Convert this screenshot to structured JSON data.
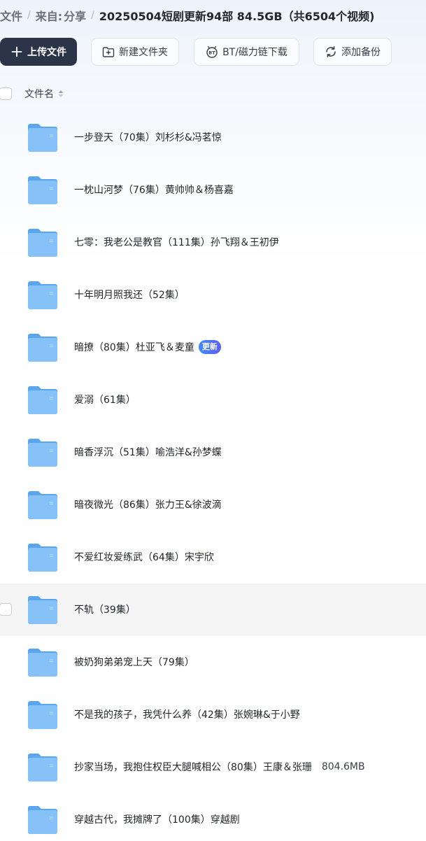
{
  "breadcrumb": {
    "root": "文件",
    "from": "来自:",
    "share": "分享",
    "current": "20250504短剧更新94部 84.5GB（共6504个视频)"
  },
  "toolbar": {
    "upload": "上传文件",
    "new_folder": "新建文件夹",
    "bt_download": "BT/磁力链下载",
    "add_backup": "添加备份"
  },
  "list_header": {
    "filename": "文件名"
  },
  "files": [
    {
      "name": "一步登天（70集）刘杉杉&冯茗惊"
    },
    {
      "name": "一枕山河梦（76集）黄帅帅＆杨喜嘉"
    },
    {
      "name": "七零：我老公是教官（111集）孙飞翔＆王初伊"
    },
    {
      "name": "十年明月照我还（52集）"
    },
    {
      "name": "暗撩（80集）杜亚飞＆麦童",
      "badge": "更新"
    },
    {
      "name": "爱溺（61集）"
    },
    {
      "name": "暗香浮沉（51集）喻浩洋&孙梦蝶"
    },
    {
      "name": "暗夜微光（86集）张力王&徐波滴"
    },
    {
      "name": "不爱红妆爱练武（64集）宋宇欣"
    },
    {
      "name": "不轨（39集）"
    },
    {
      "name": "被奶狗弟弟宠上天（79集）"
    },
    {
      "name": "不是我的孩子，我凭什么养（42集）张婉琳&于小野"
    },
    {
      "name": "抄家当场，我抱住权臣大腿喊相公（80集）王康＆张珊",
      "size": "804.6MB"
    },
    {
      "name": "穿越古代，我摊牌了（100集）穿越剧"
    }
  ],
  "colors": {
    "primary_button": "#2c3447",
    "badge_gradient_start": "#3f8cff",
    "badge_gradient_end": "#5b5df6",
    "folder": "#6cb4f5",
    "row_hover": "#f5f5f6"
  },
  "icons": {
    "upload": "plus-icon",
    "new_folder": "folder-plus-icon",
    "bt": "bt-icon",
    "backup": "sync-icon",
    "sort": "sort-icon",
    "folder": "folder-icon"
  },
  "state": {
    "hovered_row_index": 9
  }
}
